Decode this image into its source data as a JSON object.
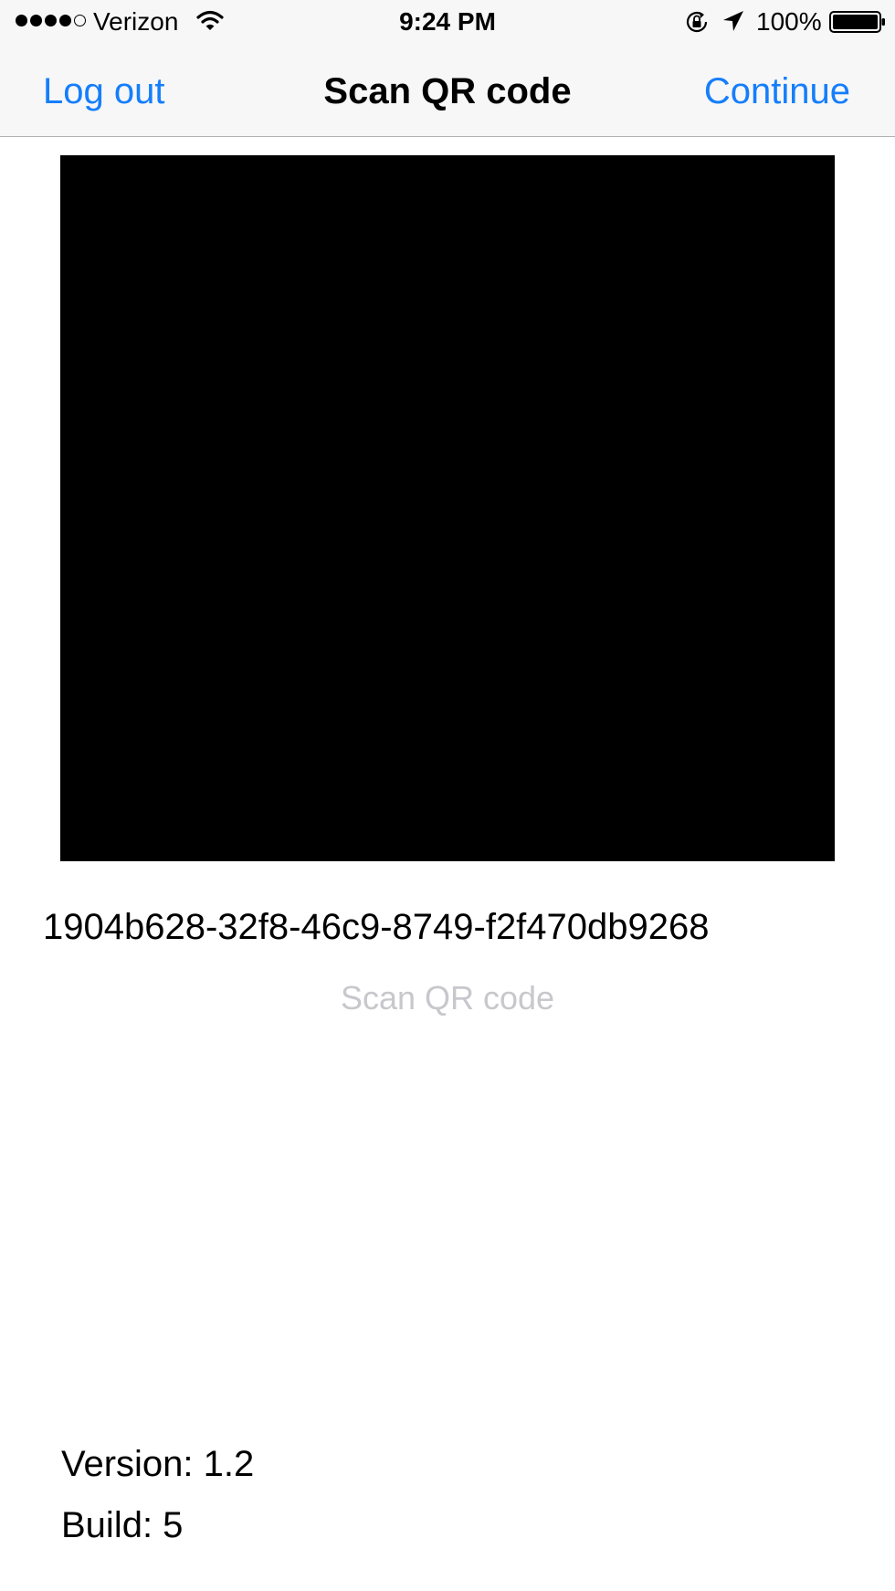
{
  "status_bar": {
    "signal_filled": 4,
    "signal_total": 5,
    "carrier": "Verizon",
    "time": "9:24 PM",
    "battery_percent": "100%",
    "icons": [
      "wifi-icon",
      "rotation-lock-icon",
      "location-arrow-icon",
      "battery-icon"
    ]
  },
  "nav": {
    "left_label": "Log out",
    "title": "Scan QR code",
    "right_label": "Continue"
  },
  "main": {
    "scanned_code": "1904b628-32f8-46c9-8749-f2f470db9268",
    "scan_button_label": "Scan QR code"
  },
  "footer": {
    "version": "Version: 1.2",
    "build": "Build: 5"
  },
  "colors": {
    "accent": "#157efb",
    "disabled_text": "#c7c7cc",
    "bar_background": "#f7f7f7",
    "preview_background": "#000000"
  }
}
